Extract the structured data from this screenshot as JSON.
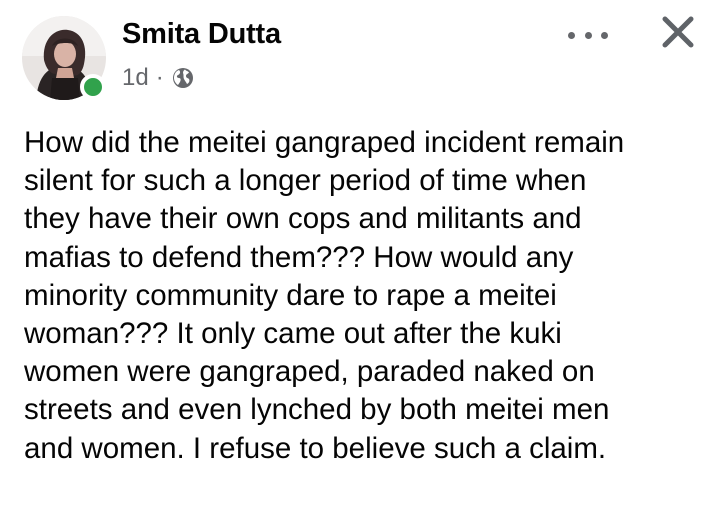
{
  "post": {
    "author": "Smita Dutta",
    "time": "1d",
    "separator": "·",
    "privacy_icon": "globe-icon",
    "more_icon": "more-dots-icon",
    "close_icon": "close-icon",
    "online_color": "#31a24c",
    "text": "How did the meitei gangraped incident remain\nsilent for such a longer period of time when\nthey have their own cops and militants and\nmafias to defend them??? How would any\nminority community dare to rape a meitei\nwoman??? It only came out after the kuki\nwomen were gangraped, paraded naked on\nstreets and even lynched by both meitei men\nand women. I refuse to believe such a claim."
  }
}
